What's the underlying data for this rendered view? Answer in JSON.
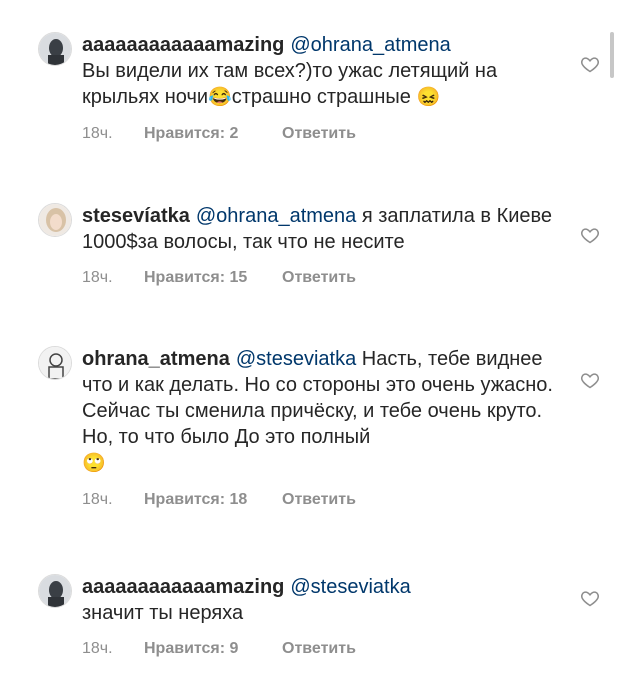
{
  "comments": [
    {
      "username": "aaaaaaaaaaaamazing",
      "mention": "@ohrana_atmena",
      "text": "Вы видели их там всех?)то ужас летящий на крыльях ночи",
      "emoji1": "😂",
      "text2": "страшно страшные",
      "emoji2": "😖",
      "time": "18ч.",
      "likes": "Нравится: 2",
      "reply": "Ответить"
    },
    {
      "username": "stesevíatka",
      "mention": "@ohrana_atmena",
      "text": "я заплатила в Киеве 1000$за волосы, так что не несите",
      "time": "18ч.",
      "likes": "Нравится: 15",
      "reply": "Ответить"
    },
    {
      "username": "ohrana_atmena",
      "mention": "@steseviatka",
      "text": "Насть, тебе виднее что и как делать. Но со стороны это очень ужасно. Сейчас ты сменила причёску, и тебе очень круто. Но, то что было До это полный",
      "emoji1": "🙄",
      "time": "18ч.",
      "likes": "Нравится: 18",
      "reply": "Ответить"
    },
    {
      "username": "aaaaaaaaaaaamazing",
      "mention": "@steseviatka",
      "text": "значит ты неряха",
      "time": "18ч.",
      "likes": "Нравится: 9",
      "reply": "Ответить"
    }
  ]
}
